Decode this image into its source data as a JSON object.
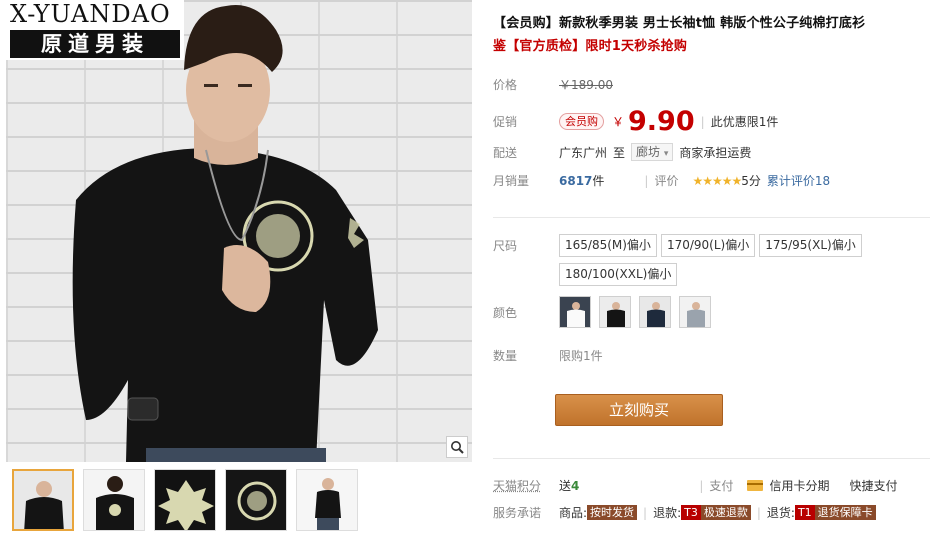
{
  "brand": {
    "en": "X-YUANDAO",
    "cn": "原道男装"
  },
  "product": {
    "title_part1": "【会员购】新款秋季男装 男士长袖t恤 韩版个性公子纯棉打底衫",
    "title_part2": "鉴【官方质检】限时1天秒杀抢购"
  },
  "price": {
    "label": "价格",
    "original": "￥189.00",
    "promo_label": "促销",
    "promo_badge": "会员购",
    "currency": "￥",
    "value": "9.90",
    "limit": "此优惠限1件"
  },
  "shipping": {
    "label": "配送",
    "from": "广东广州",
    "to_word": "至",
    "destination": "廊坊",
    "note": "商家承担运费"
  },
  "sales": {
    "label": "月销量",
    "count": "6817",
    "unit": "件",
    "rating_label": "评价",
    "stars": "★★★★★",
    "score": "5分",
    "reviews": "累计评价18"
  },
  "size": {
    "label": "尺码",
    "options": [
      "165/85(M)偏小",
      "170/90(L)偏小",
      "175/95(XL)偏小",
      "180/100(XXL)偏小"
    ]
  },
  "color": {
    "label": "颜色"
  },
  "quantity": {
    "label": "数量",
    "limit": "限购1件"
  },
  "buy_button": "立刻购买",
  "points": {
    "label": "天猫积分",
    "give": "送",
    "value": "4",
    "pay_label": "支付",
    "credit": "信用卡分期",
    "fast": "快捷支付"
  },
  "service": {
    "label": "服务承诺",
    "goods_label": "商品:",
    "goods_tag": "按时发货",
    "refund_label": "退款:",
    "refund_code": "T3",
    "refund_tag": "极速退款",
    "return_label": "退货:",
    "return_code": "T1",
    "return_tag": "退货保障卡"
  },
  "colors": {
    "accent_red": "#c40000",
    "button": "#c9823b",
    "link_blue": "#3a6aa0"
  },
  "icons": [
    "zoom-icon",
    "credit-card-icon",
    "dropdown-icon"
  ]
}
